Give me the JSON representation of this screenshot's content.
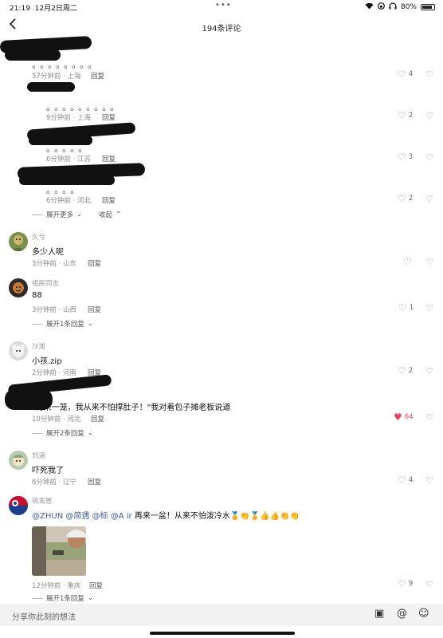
{
  "status_bar": {
    "time": "21:19",
    "date": "12月2日周二",
    "battery": "80%",
    "dots": "•••"
  },
  "header": {
    "title": "194条评论",
    "back_icon": "chevron-left-icon"
  },
  "redacted_replies": [
    {
      "dots": "。。。。。。。。",
      "meta": "57分钟前 · 上海",
      "reply": "回复",
      "likes": "4"
    },
    {
      "dots": "。。。。。。。。。",
      "meta": "9分钟前 · 上海",
      "reply": "回复",
      "likes": "2"
    },
    {
      "dots": "。。。。。",
      "meta": "6分钟前 · 江苏",
      "reply": "回复",
      "likes": "3"
    },
    {
      "dots": "。。。。",
      "meta": "6分钟前 · 河北",
      "reply": "回复",
      "likes": "2"
    }
  ],
  "thread_controls": {
    "expand_more": "展开更多",
    "collapse": "收起"
  },
  "comments": [
    {
      "user": "久兮",
      "text": "多少人呢",
      "meta": "3分钟前 · 山东",
      "reply": "回复",
      "likes": ""
    },
    {
      "user": "祖民同志",
      "text": "88",
      "meta": "3分钟前 · 山西",
      "reply": "回复",
      "likes": "1",
      "expand": "展开1条回复"
    },
    {
      "user": "沙滩",
      "text": "小孩.zip",
      "meta": "2分钟前 · 河南",
      "reply": "回复",
      "likes": "2"
    },
    {
      "user": "",
      "text": "\"再来一笼，我从来不怕撑肚子！\"我对着包子摊老板说道",
      "meta": "10分钟前 · 河北",
      "reply": "回复",
      "likes": "64",
      "liked": true,
      "expand": "展开2条回复"
    },
    {
      "user": "刘涵",
      "text": "吓死我了",
      "meta": "6分钟前 · 辽宁",
      "reply": "回复",
      "likes": "4"
    },
    {
      "user": "筑鸾思",
      "mentions": [
        "@ZHUN",
        "@简遇",
        "@标",
        "@A ir"
      ],
      "text": "再来一盆！从来不怕泼冷水",
      "emoji": "🏅👏🏅👍👍👏👏",
      "meta": "12分钟前 · 重庆",
      "reply": "回复",
      "likes": "9",
      "expand": "展开1条回复"
    }
  ],
  "input_bar": {
    "placeholder": "分享你此刻的想法",
    "icons": [
      "image-icon",
      "at-icon",
      "emoji-icon"
    ],
    "image_glyph": "▣",
    "at_glyph": "@",
    "emoji_glyph": "☺"
  },
  "colors": {
    "like_red": "#e8435a",
    "mention_blue": "#3d5aa8",
    "meta_gray": "#8c8c8c"
  }
}
